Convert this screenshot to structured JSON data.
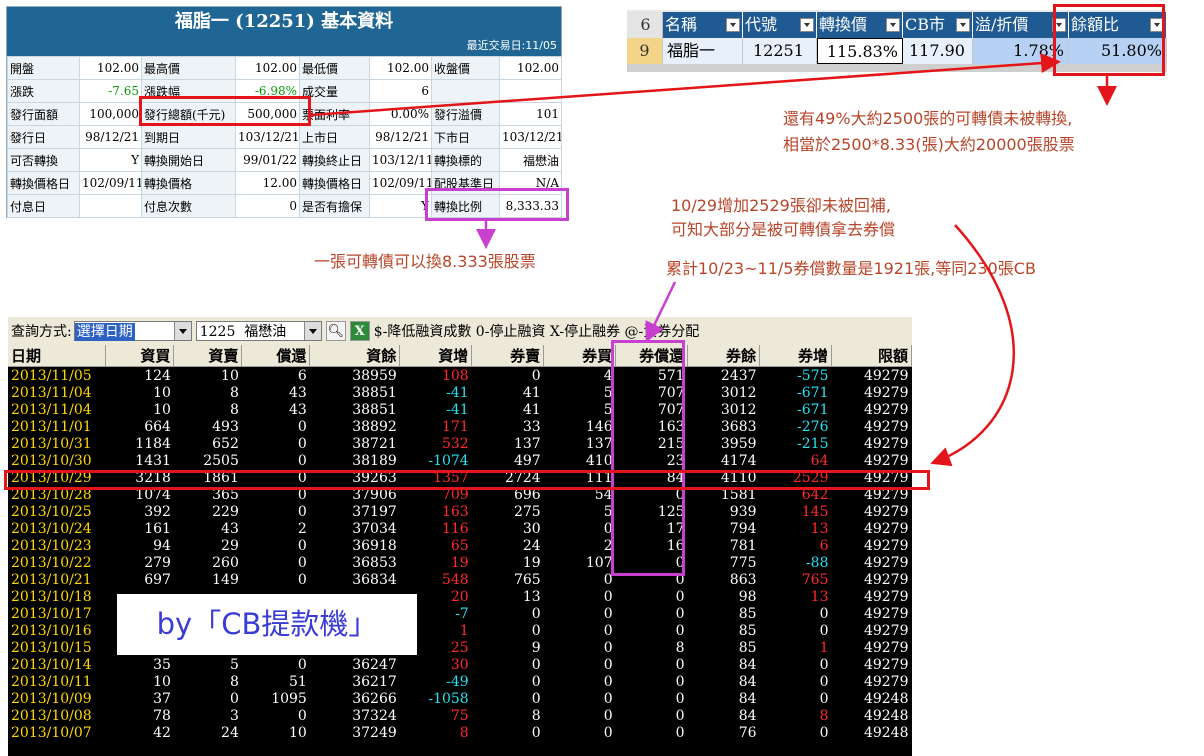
{
  "info": {
    "title": "福脂一 (12251)  基本資料",
    "last_trade": "最近交易日:11/05",
    "rows": [
      [
        "開盤",
        "102.00",
        "最高價",
        "102.00",
        "最低價",
        "102.00",
        "收盤價",
        "102.00"
      ],
      [
        "漲跌",
        "-7.65",
        "漲跌幅",
        "-6.98%",
        "成交量",
        "6",
        "",
        ""
      ],
      [
        "發行面額",
        "100,000",
        "發行總額(千元)",
        "500,000",
        "票面利率",
        "0.00%",
        "發行溢價",
        "101"
      ],
      [
        "發行日",
        "98/12/21",
        "到期日",
        "103/12/21",
        "上市日",
        "98/12/21",
        "下市日",
        "103/12/21"
      ],
      [
        "可否轉換",
        "Y",
        "轉換開始日",
        "99/01/22",
        "轉換終止日",
        "103/12/11",
        "轉換標的",
        "福懋油"
      ],
      [
        "轉換價格日",
        "102/09/11",
        "轉換價格",
        "12.00",
        "轉換價格日",
        "102/09/11",
        "配股基準日",
        "N/A"
      ],
      [
        "付息日",
        "",
        "付息次數",
        "0",
        "是否有擔保",
        "Y",
        "轉換比例",
        "8,333.33"
      ]
    ]
  },
  "excel": {
    "header_rownum": "6",
    "headers": [
      "名稱",
      "代號",
      "轉換價",
      "CB市",
      "溢/折價",
      "餘額比"
    ],
    "rownum": "9",
    "values": [
      "福脂一",
      "12251",
      "115.83%",
      "117.90",
      "1.78%",
      "51.80%"
    ]
  },
  "annotations": {
    "balance_note_1": "還有49%大約2500張的可轉債未被轉換,",
    "balance_note_2": "相當於2500*8.33(張)大約20000張股票",
    "ratio_note": "一張可轉債可以換8.333張股票",
    "repay_note_1": "10/29增加2529張卻未被回補,",
    "repay_note_2": "可知大部分是被可轉債拿去券償",
    "sum_note": "累計10/23~11/5券償數量是1921張,等同230張CB",
    "watermark": "by「CB提款機」"
  },
  "toolbar": {
    "query_label": "查詢方式:",
    "mode": "選擇日期",
    "code": "1225",
    "stock": "福懋油",
    "legend": "$-降低融資成數  0-停止融資  X-停止融券  @-資券分配"
  },
  "grid": {
    "headers": [
      "日期",
      "資買",
      "資賣",
      "償還",
      "資餘",
      "資增",
      "券賣",
      "券買",
      "券償還",
      "券餘",
      "券增",
      "限額"
    ],
    "rows": [
      [
        "2013/11/05",
        "124",
        "10",
        "6",
        "38959",
        "108",
        "0",
        "4",
        "571",
        "2437",
        "-575",
        "49279"
      ],
      [
        "2013/11/04",
        "10",
        "8",
        "43",
        "38851",
        "-41",
        "41",
        "5",
        "707",
        "3012",
        "-671",
        "49279"
      ],
      [
        "2013/11/04",
        "10",
        "8",
        "43",
        "38851",
        "-41",
        "41",
        "5",
        "707",
        "3012",
        "-671",
        "49279"
      ],
      [
        "2013/11/01",
        "664",
        "493",
        "0",
        "38892",
        "171",
        "33",
        "146",
        "163",
        "3683",
        "-276",
        "49279"
      ],
      [
        "2013/10/31",
        "1184",
        "652",
        "0",
        "38721",
        "532",
        "137",
        "137",
        "215",
        "3959",
        "-215",
        "49279"
      ],
      [
        "2013/10/30",
        "1431",
        "2505",
        "0",
        "38189",
        "-1074",
        "497",
        "410",
        "23",
        "4174",
        "64",
        "49279"
      ],
      [
        "2013/10/29",
        "3218",
        "1861",
        "0",
        "39263",
        "1357",
        "2724",
        "111",
        "84",
        "4110",
        "2529",
        "49279"
      ],
      [
        "2013/10/28",
        "1074",
        "365",
        "0",
        "37906",
        "709",
        "696",
        "54",
        "0",
        "1581",
        "642",
        "49279"
      ],
      [
        "2013/10/25",
        "392",
        "229",
        "0",
        "37197",
        "163",
        "275",
        "5",
        "125",
        "939",
        "145",
        "49279"
      ],
      [
        "2013/10/24",
        "161",
        "43",
        "2",
        "37034",
        "116",
        "30",
        "0",
        "17",
        "794",
        "13",
        "49279"
      ],
      [
        "2013/10/23",
        "94",
        "29",
        "0",
        "36918",
        "65",
        "24",
        "2",
        "16",
        "781",
        "6",
        "49279"
      ],
      [
        "2013/10/22",
        "279",
        "260",
        "0",
        "36853",
        "19",
        "19",
        "107",
        "0",
        "775",
        "-88",
        "49279"
      ],
      [
        "2013/10/21",
        "697",
        "149",
        "0",
        "36834",
        "548",
        "765",
        "0",
        "0",
        "863",
        "765",
        "49279"
      ],
      [
        "2013/10/18",
        "",
        "",
        "",
        "",
        "20",
        "13",
        "0",
        "0",
        "98",
        "13",
        "49279"
      ],
      [
        "2013/10/17",
        "",
        "",
        "",
        "",
        "-7",
        "0",
        "0",
        "0",
        "85",
        "0",
        "49279"
      ],
      [
        "2013/10/16",
        "",
        "",
        "",
        "",
        "1",
        "0",
        "0",
        "0",
        "85",
        "0",
        "49279"
      ],
      [
        "2013/10/15",
        "",
        "",
        "",
        "",
        "25",
        "9",
        "0",
        "8",
        "85",
        "1",
        "49279"
      ],
      [
        "2013/10/14",
        "35",
        "5",
        "0",
        "36247",
        "30",
        "0",
        "0",
        "0",
        "84",
        "0",
        "49279"
      ],
      [
        "2013/10/11",
        "10",
        "8",
        "51",
        "36217",
        "-49",
        "0",
        "0",
        "0",
        "84",
        "0",
        "49279"
      ],
      [
        "2013/10/09",
        "37",
        "0",
        "1095",
        "36266",
        "-1058",
        "0",
        "0",
        "0",
        "84",
        "0",
        "49248"
      ],
      [
        "2013/10/08",
        "78",
        "3",
        "0",
        "37324",
        "75",
        "8",
        "0",
        "0",
        "84",
        "8",
        "49248"
      ],
      [
        "2013/10/07",
        "42",
        "24",
        "10",
        "37249",
        "8",
        "0",
        "0",
        "0",
        "76",
        "0",
        "49248"
      ]
    ]
  },
  "colors": {
    "accent_red": "#e3151a",
    "accent_purple": "#c93fd0",
    "note_brown": "#b8452a"
  }
}
